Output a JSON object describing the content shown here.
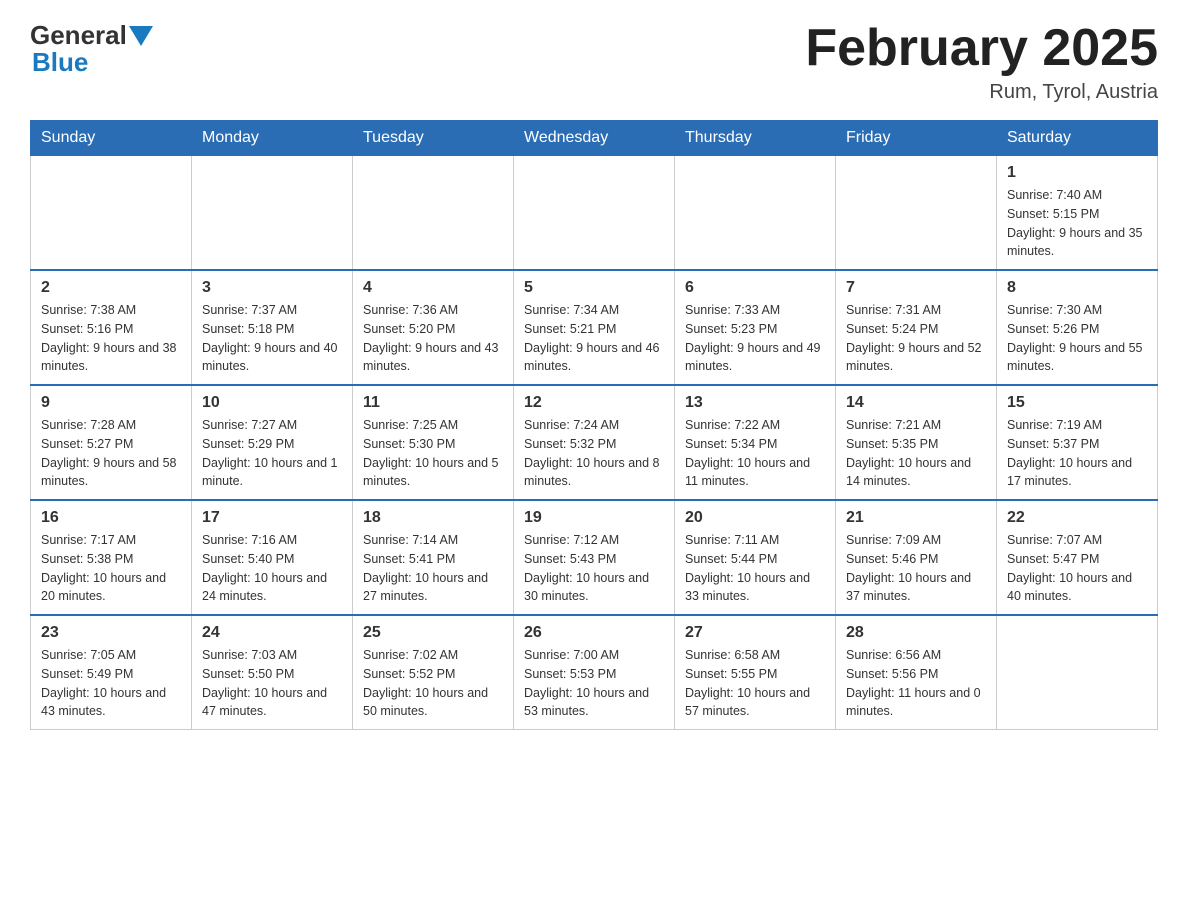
{
  "header": {
    "logo_general": "General",
    "logo_blue": "Blue",
    "title": "February 2025",
    "subtitle": "Rum, Tyrol, Austria"
  },
  "days_of_week": [
    "Sunday",
    "Monday",
    "Tuesday",
    "Wednesday",
    "Thursday",
    "Friday",
    "Saturday"
  ],
  "weeks": [
    [
      {
        "day": "",
        "sunrise": "",
        "sunset": "",
        "daylight": ""
      },
      {
        "day": "",
        "sunrise": "",
        "sunset": "",
        "daylight": ""
      },
      {
        "day": "",
        "sunrise": "",
        "sunset": "",
        "daylight": ""
      },
      {
        "day": "",
        "sunrise": "",
        "sunset": "",
        "daylight": ""
      },
      {
        "day": "",
        "sunrise": "",
        "sunset": "",
        "daylight": ""
      },
      {
        "day": "",
        "sunrise": "",
        "sunset": "",
        "daylight": ""
      },
      {
        "day": "1",
        "sunrise": "Sunrise: 7:40 AM",
        "sunset": "Sunset: 5:15 PM",
        "daylight": "Daylight: 9 hours and 35 minutes."
      }
    ],
    [
      {
        "day": "2",
        "sunrise": "Sunrise: 7:38 AM",
        "sunset": "Sunset: 5:16 PM",
        "daylight": "Daylight: 9 hours and 38 minutes."
      },
      {
        "day": "3",
        "sunrise": "Sunrise: 7:37 AM",
        "sunset": "Sunset: 5:18 PM",
        "daylight": "Daylight: 9 hours and 40 minutes."
      },
      {
        "day": "4",
        "sunrise": "Sunrise: 7:36 AM",
        "sunset": "Sunset: 5:20 PM",
        "daylight": "Daylight: 9 hours and 43 minutes."
      },
      {
        "day": "5",
        "sunrise": "Sunrise: 7:34 AM",
        "sunset": "Sunset: 5:21 PM",
        "daylight": "Daylight: 9 hours and 46 minutes."
      },
      {
        "day": "6",
        "sunrise": "Sunrise: 7:33 AM",
        "sunset": "Sunset: 5:23 PM",
        "daylight": "Daylight: 9 hours and 49 minutes."
      },
      {
        "day": "7",
        "sunrise": "Sunrise: 7:31 AM",
        "sunset": "Sunset: 5:24 PM",
        "daylight": "Daylight: 9 hours and 52 minutes."
      },
      {
        "day": "8",
        "sunrise": "Sunrise: 7:30 AM",
        "sunset": "Sunset: 5:26 PM",
        "daylight": "Daylight: 9 hours and 55 minutes."
      }
    ],
    [
      {
        "day": "9",
        "sunrise": "Sunrise: 7:28 AM",
        "sunset": "Sunset: 5:27 PM",
        "daylight": "Daylight: 9 hours and 58 minutes."
      },
      {
        "day": "10",
        "sunrise": "Sunrise: 7:27 AM",
        "sunset": "Sunset: 5:29 PM",
        "daylight": "Daylight: 10 hours and 1 minute."
      },
      {
        "day": "11",
        "sunrise": "Sunrise: 7:25 AM",
        "sunset": "Sunset: 5:30 PM",
        "daylight": "Daylight: 10 hours and 5 minutes."
      },
      {
        "day": "12",
        "sunrise": "Sunrise: 7:24 AM",
        "sunset": "Sunset: 5:32 PM",
        "daylight": "Daylight: 10 hours and 8 minutes."
      },
      {
        "day": "13",
        "sunrise": "Sunrise: 7:22 AM",
        "sunset": "Sunset: 5:34 PM",
        "daylight": "Daylight: 10 hours and 11 minutes."
      },
      {
        "day": "14",
        "sunrise": "Sunrise: 7:21 AM",
        "sunset": "Sunset: 5:35 PM",
        "daylight": "Daylight: 10 hours and 14 minutes."
      },
      {
        "day": "15",
        "sunrise": "Sunrise: 7:19 AM",
        "sunset": "Sunset: 5:37 PM",
        "daylight": "Daylight: 10 hours and 17 minutes."
      }
    ],
    [
      {
        "day": "16",
        "sunrise": "Sunrise: 7:17 AM",
        "sunset": "Sunset: 5:38 PM",
        "daylight": "Daylight: 10 hours and 20 minutes."
      },
      {
        "day": "17",
        "sunrise": "Sunrise: 7:16 AM",
        "sunset": "Sunset: 5:40 PM",
        "daylight": "Daylight: 10 hours and 24 minutes."
      },
      {
        "day": "18",
        "sunrise": "Sunrise: 7:14 AM",
        "sunset": "Sunset: 5:41 PM",
        "daylight": "Daylight: 10 hours and 27 minutes."
      },
      {
        "day": "19",
        "sunrise": "Sunrise: 7:12 AM",
        "sunset": "Sunset: 5:43 PM",
        "daylight": "Daylight: 10 hours and 30 minutes."
      },
      {
        "day": "20",
        "sunrise": "Sunrise: 7:11 AM",
        "sunset": "Sunset: 5:44 PM",
        "daylight": "Daylight: 10 hours and 33 minutes."
      },
      {
        "day": "21",
        "sunrise": "Sunrise: 7:09 AM",
        "sunset": "Sunset: 5:46 PM",
        "daylight": "Daylight: 10 hours and 37 minutes."
      },
      {
        "day": "22",
        "sunrise": "Sunrise: 7:07 AM",
        "sunset": "Sunset: 5:47 PM",
        "daylight": "Daylight: 10 hours and 40 minutes."
      }
    ],
    [
      {
        "day": "23",
        "sunrise": "Sunrise: 7:05 AM",
        "sunset": "Sunset: 5:49 PM",
        "daylight": "Daylight: 10 hours and 43 minutes."
      },
      {
        "day": "24",
        "sunrise": "Sunrise: 7:03 AM",
        "sunset": "Sunset: 5:50 PM",
        "daylight": "Daylight: 10 hours and 47 minutes."
      },
      {
        "day": "25",
        "sunrise": "Sunrise: 7:02 AM",
        "sunset": "Sunset: 5:52 PM",
        "daylight": "Daylight: 10 hours and 50 minutes."
      },
      {
        "day": "26",
        "sunrise": "Sunrise: 7:00 AM",
        "sunset": "Sunset: 5:53 PM",
        "daylight": "Daylight: 10 hours and 53 minutes."
      },
      {
        "day": "27",
        "sunrise": "Sunrise: 6:58 AM",
        "sunset": "Sunset: 5:55 PM",
        "daylight": "Daylight: 10 hours and 57 minutes."
      },
      {
        "day": "28",
        "sunrise": "Sunrise: 6:56 AM",
        "sunset": "Sunset: 5:56 PM",
        "daylight": "Daylight: 11 hours and 0 minutes."
      },
      {
        "day": "",
        "sunrise": "",
        "sunset": "",
        "daylight": ""
      }
    ]
  ]
}
